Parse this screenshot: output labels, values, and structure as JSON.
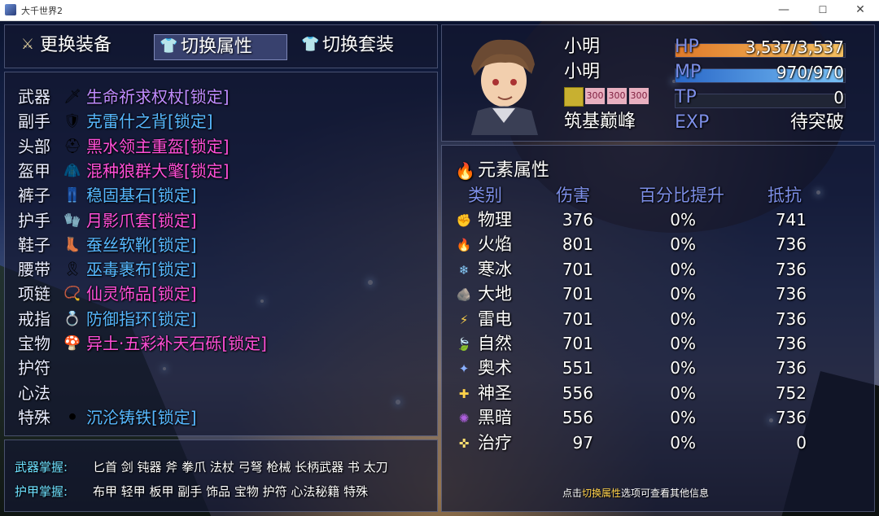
{
  "window": {
    "title": "大千世界2",
    "min": "—",
    "max": "☐",
    "close": "✕"
  },
  "menu": [
    {
      "label": "更换装备",
      "icon": "swap-gear-icon",
      "active": false
    },
    {
      "label": "切换属性",
      "icon": "armor-icon",
      "active": true
    },
    {
      "label": "切换套装",
      "icon": "armor-icon",
      "active": false
    }
  ],
  "equipment": [
    {
      "slot": "武器",
      "item": "生命祈求权杖[锁定]",
      "color": "#c08cff",
      "icon": "staff-icon"
    },
    {
      "slot": "副手",
      "item": "克雷什之背[锁定]",
      "color": "#57b8ff",
      "icon": "shell-icon"
    },
    {
      "slot": "头部",
      "item": "黑水领主重盔[锁定]",
      "color": "#ff4fd8",
      "icon": "helmet-icon"
    },
    {
      "slot": "盔甲",
      "item": "混种狼群大氅[锁定]",
      "color": "#ff4fd8",
      "icon": "cloak-icon"
    },
    {
      "slot": "裤子",
      "item": "稳固基石[锁定]",
      "color": "#57b8ff",
      "icon": "pants-icon"
    },
    {
      "slot": "护手",
      "item": "月影爪套[锁定]",
      "color": "#ff4fd8",
      "icon": "gauntlet-icon"
    },
    {
      "slot": "鞋子",
      "item": "蚕丝软靴[锁定]",
      "color": "#57b8ff",
      "icon": "boots-icon"
    },
    {
      "slot": "腰带",
      "item": "巫毒裹布[锁定]",
      "color": "#57b8ff",
      "icon": "belt-icon"
    },
    {
      "slot": "项链",
      "item": "仙灵饰品[锁定]",
      "color": "#ff4fd8",
      "icon": "necklace-icon"
    },
    {
      "slot": "戒指",
      "item": "防御指环[锁定]",
      "color": "#57b8ff",
      "icon": "ring-icon"
    },
    {
      "slot": "宝物",
      "item": "异土·五彩补天石砾[锁定]",
      "color": "#ff4fd8",
      "icon": "treasure-icon"
    },
    {
      "slot": "护符",
      "item": "",
      "color": "#ffffff",
      "icon": ""
    },
    {
      "slot": "心法",
      "item": "",
      "color": "#ffffff",
      "icon": ""
    },
    {
      "slot": "特殊",
      "item": "沉沦铸铁[锁定]",
      "color": "#57b8ff",
      "icon": "iron-icon"
    }
  ],
  "mastery": {
    "weapon_label": "武器掌握:",
    "weapon_list": "匕首 剑 钝器 斧 拳爪 法杖 弓弩 枪械 长柄武器 书 太刀",
    "armor_label": "护甲掌握:",
    "armor_list": "布甲 轻甲 板甲 副手 饰品 宝物 护符 心法秘籍 特殊"
  },
  "character": {
    "name": "小明",
    "class": "小明",
    "realm": "筑基巅峰",
    "states": [
      "300",
      "300",
      "300"
    ],
    "hp_label": "HP",
    "hp_value": "3,537/3,537",
    "hp_fill": 1.0,
    "mp_label": "MP",
    "mp_value": "970/970",
    "mp_fill": 1.0,
    "tp_label": "TP",
    "tp_value": "0",
    "tp_fill": 0.0,
    "exp_label": "EXP",
    "exp_value": "待突破"
  },
  "colors": {
    "hp": "#f0a040",
    "mp": "#4a9ae8",
    "stat_label": "#7d8fe8"
  },
  "elements": {
    "title": "元素属性",
    "title_icon": "fire-icon",
    "headers": [
      "类别",
      "伤害",
      "百分比提升",
      "抵抗"
    ],
    "rows": [
      {
        "name": "物理",
        "icon": "fist-icon",
        "damage": "376",
        "pct": "0%",
        "resist": "741"
      },
      {
        "name": "火焰",
        "icon": "flame-icon",
        "damage": "801",
        "pct": "0%",
        "resist": "736"
      },
      {
        "name": "寒冰",
        "icon": "snowflake-icon",
        "damage": "701",
        "pct": "0%",
        "resist": "736"
      },
      {
        "name": "大地",
        "icon": "rock-icon",
        "damage": "701",
        "pct": "0%",
        "resist": "736"
      },
      {
        "name": "雷电",
        "icon": "lightning-icon",
        "damage": "701",
        "pct": "0%",
        "resist": "736"
      },
      {
        "name": "自然",
        "icon": "leaf-icon",
        "damage": "701",
        "pct": "0%",
        "resist": "736"
      },
      {
        "name": "奥术",
        "icon": "arcane-icon",
        "damage": "551",
        "pct": "0%",
        "resist": "736"
      },
      {
        "name": "神圣",
        "icon": "holy-icon",
        "damage": "556",
        "pct": "0%",
        "resist": "752"
      },
      {
        "name": "黑暗",
        "icon": "dark-icon",
        "damage": "556",
        "pct": "0%",
        "resist": "736"
      },
      {
        "name": "治疗",
        "icon": "heal-icon",
        "damage": "97",
        "pct": "0%",
        "resist": "0"
      }
    ]
  },
  "hint": {
    "prefix": "点击",
    "highlight": "切换属性",
    "suffix": "选项可查看其他信息"
  }
}
